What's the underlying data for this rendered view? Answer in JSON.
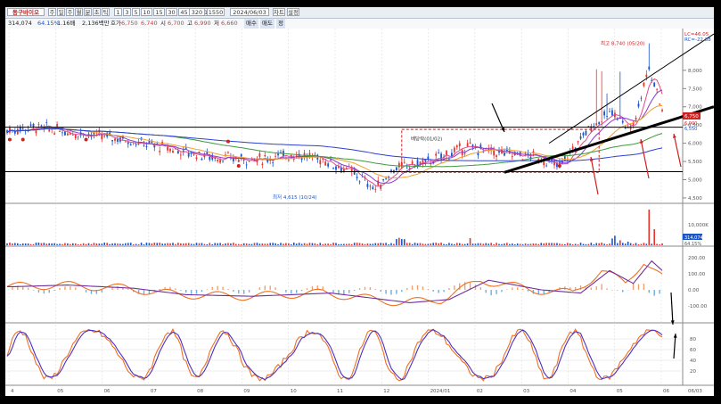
{
  "toolbar": {
    "stock_name": "동구바이오",
    "buttons": [
      "주",
      "일",
      "주",
      "월",
      "분",
      "초",
      "틱"
    ],
    "periods": [
      "1",
      "3",
      "5",
      "10",
      "15",
      "30",
      "45",
      "60",
      "120"
    ],
    "count": "320",
    "range": "1550",
    "date": "2024/06/03",
    "right_buttons": [
      "차트",
      "설정"
    ]
  },
  "infobar": {
    "volume": "314,074",
    "turnover_pct": "64.15%",
    "multiple": "1.16배",
    "amount": "2,136백만",
    "quote_label": "호가",
    "bid": "6,750",
    "ask": "6,740",
    "open_label": "시",
    "open": "6,700",
    "high_label": "고",
    "high": "6,990",
    "low_label": "저",
    "low": "6,660",
    "tags": [
      "매수",
      "매도",
      "정"
    ]
  },
  "price_panel": {
    "ticks": [
      "8,000",
      "7,500",
      "7,000",
      "6,500",
      "6,000",
      "5,500",
      "5,000",
      "4,500"
    ],
    "header_lines": [
      "LC=46.05",
      "RC=-22.88"
    ],
    "annot_high": "최고 8,740 (05/20)",
    "annot_low": "최저 4,615 (10/24)",
    "annot_mid": "배당락(01/02)",
    "current_price": "6,750",
    "side_labels": [
      "6,900",
      "6,550"
    ]
  },
  "volume_panel": {
    "tick": "10,000K",
    "current": "314,074",
    "pct": "64.15%"
  },
  "macd_panel": {
    "ticks": [
      "200.00",
      "100.00",
      "0.00",
      "-100.00"
    ]
  },
  "stoch_panel": {
    "ticks": [
      "80",
      "60",
      "40",
      "20"
    ]
  },
  "x_axis": {
    "labels": [
      "4",
      "05",
      "06",
      "07",
      "08",
      "09",
      "10",
      "11",
      "12",
      "2024/01",
      "02",
      "03",
      "04",
      "05",
      "06"
    ],
    "end_label": "06/03"
  },
  "colors": {
    "up": "#e8322c",
    "down": "#1a55c8",
    "ma_blue": "#2d3fd0",
    "ma_green": "#3c9a3c",
    "ma_orange": "#f0a030",
    "trend": "#000000"
  }
}
